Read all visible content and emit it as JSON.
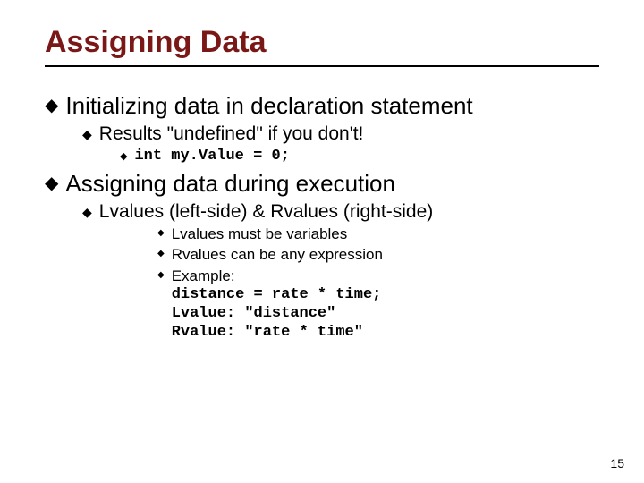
{
  "title": "Assigning Data",
  "bullets": {
    "b1": "Initializing data in declaration statement",
    "b1_1": "Results \"undefined\" if you don't!",
    "b1_1_1_code": "int my.Value = 0;",
    "b2": "Assigning data during execution",
    "b2_1": "Lvalues (left-side) & Rvalues (right-side)",
    "b2_1_1": "Lvalues must be variables",
    "b2_1_2": "Rvalues can be any expression",
    "b2_1_3": "Example:",
    "b2_1_3_code1": "distance = rate * time;",
    "b2_1_3_code2": "Lvalue:  \"distance\"",
    "b2_1_3_code3": "Rvalue:  \"rate * time\""
  },
  "page_number": "15"
}
